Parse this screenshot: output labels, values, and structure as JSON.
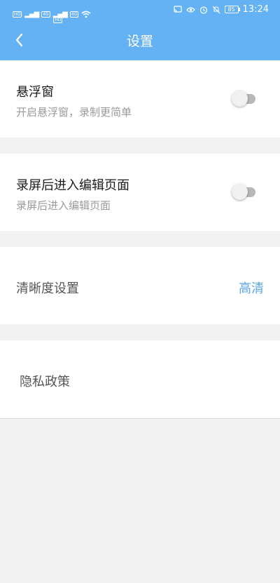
{
  "status_bar": {
    "hd_labels": [
      "HD",
      "HD"
    ],
    "network_labels": [
      "4G",
      "4G"
    ],
    "battery": "85",
    "time": "13:24"
  },
  "header": {
    "title": "设置",
    "color": "#64b1f4"
  },
  "settings": {
    "floating_window": {
      "title": "悬浮窗",
      "subtitle": "开启悬浮窗，录制更简单",
      "enabled": false
    },
    "edit_after_record": {
      "title": "录屏后进入编辑页面",
      "subtitle": "录屏后进入编辑页面",
      "enabled": false
    },
    "quality": {
      "label": "清晰度设置",
      "value": "高清",
      "value_color": "#5aa6e6"
    },
    "privacy": {
      "label": "隐私政策"
    }
  }
}
